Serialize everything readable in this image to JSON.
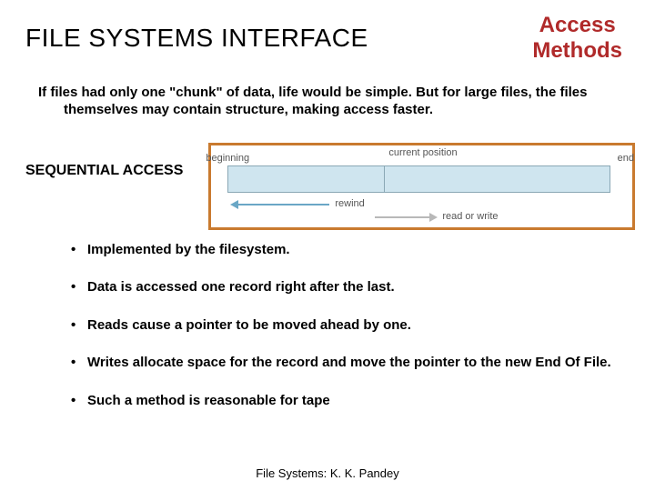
{
  "header": {
    "title": "FILE SYSTEMS INTERFACE",
    "subtitle_line1": "Access",
    "subtitle_line2": "Methods"
  },
  "intro": "If files had only one \"chunk\" of data, life would be simple. But for large files, the files themselves may contain structure, making access faster.",
  "section_title": "SEQUENTIAL ACCESS",
  "diagram": {
    "label_current": "current position",
    "label_beginning": "beginning",
    "label_end": "end",
    "label_rewind": "rewind",
    "label_readwrite": "read or write"
  },
  "bullets": [
    "Implemented by the filesystem.",
    "Data is accessed one record right after the last.",
    "Reads cause a pointer to be moved ahead by one.",
    "Writes allocate space for the record and move the pointer to the new End Of File.",
    "Such a method is reasonable for tape"
  ],
  "footer": "File Systems: K. K. Pandey"
}
